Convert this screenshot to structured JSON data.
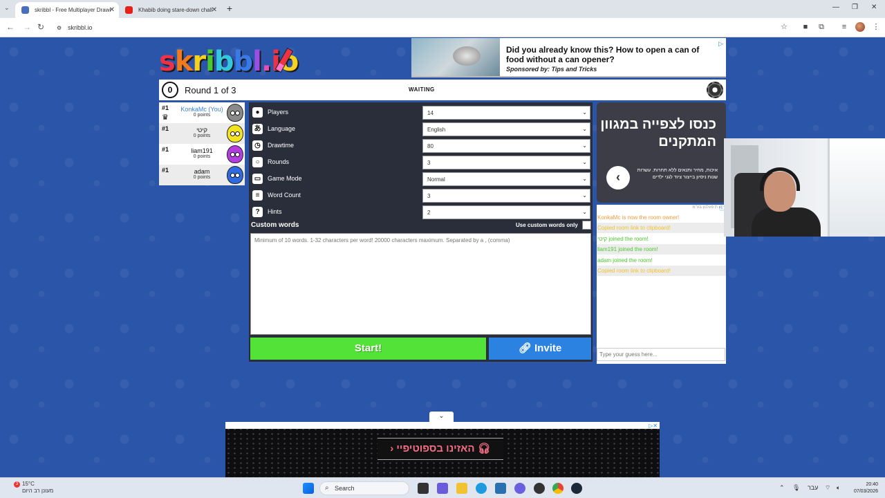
{
  "browser": {
    "tabs": [
      {
        "label": "skribbl - Free Multiplayer Drawi",
        "active": true
      },
      {
        "label": "Khabib doing stare-down chall",
        "active": false
      }
    ],
    "url": "skribbl.io"
  },
  "logo": {
    "text": "skribbl.io!"
  },
  "ad_top": {
    "title": "Did you already know this? How to open a can of food without a can opener?",
    "sponsor": "Sponsored by: Tips and Tricks"
  },
  "game": {
    "timer": "0",
    "round": "Round 1 of 3",
    "status": "WAITING"
  },
  "players": [
    {
      "rank": "#1",
      "name": "KonkaMc (You)",
      "points": "0 points",
      "owner": true,
      "color": "#8a8a8a"
    },
    {
      "rank": "#1",
      "name": "קיטי",
      "points": "0 points",
      "owner": false,
      "color": "#f2e41e"
    },
    {
      "rank": "#1",
      "name": "liam191",
      "points": "0 points",
      "owner": false,
      "color": "#b43de0"
    },
    {
      "rank": "#1",
      "name": "adam",
      "points": "0 points",
      "owner": false,
      "color": "#2f6be0"
    }
  ],
  "settings": [
    {
      "label": "Players",
      "value": "14",
      "icon": "person-icon"
    },
    {
      "label": "Language",
      "value": "English",
      "icon": "language-icon"
    },
    {
      "label": "Drawtime",
      "value": "80",
      "icon": "clock-icon"
    },
    {
      "label": "Rounds",
      "value": "3",
      "icon": "rounds-icon"
    },
    {
      "label": "Game Mode",
      "value": "Normal",
      "icon": "gamemode-icon"
    },
    {
      "label": "Word Count",
      "value": "3",
      "icon": "wordcount-icon"
    },
    {
      "label": "Hints",
      "value": "2",
      "icon": "hint-icon"
    }
  ],
  "custom_words": {
    "title": "Custom words",
    "only_label": "Use custom words only",
    "placeholder": "Minimum of 10 words. 1-32 characters per word! 20000 characters maximum. Separated by a , (comma)"
  },
  "buttons": {
    "start": "Start!",
    "invite": "Invite"
  },
  "ad_side": {
    "headline": "כנסו לצפייה במגוון המתקנים",
    "sub": "איכות, מחיר ותנאים ללא תחרות. עשרות שנות ניסיון בייצור ציוד לגני ילדים"
  },
  "chat": {
    "header": "ש ת פעלנון בע\"מ",
    "messages": [
      {
        "text": "KonkaMc is now the room owner!",
        "color": "#f29c38"
      },
      {
        "text": "Copied room link to clipboard!",
        "color": "#f2c12e"
      },
      {
        "text": "קיטי joined the room!",
        "color": "#4cc72c"
      },
      {
        "text": "liam191 joined the room!",
        "color": "#4cc72c"
      },
      {
        "text": "adam joined the room!",
        "color": "#4cc72c"
      },
      {
        "text": "Copied room link to clipboard!",
        "color": "#f2c12e"
      }
    ],
    "guess_placeholder": "Type your guess here..."
  },
  "ad_bottom": {
    "cta": "האזינו בספוטיפיי"
  },
  "taskbar": {
    "weather_temp": "15°C",
    "weather_desc": "מעונן רב היום",
    "notif_count": "3",
    "search": "Search",
    "lang": "עבר",
    "time": "20:40",
    "date": "07/03/2026"
  }
}
